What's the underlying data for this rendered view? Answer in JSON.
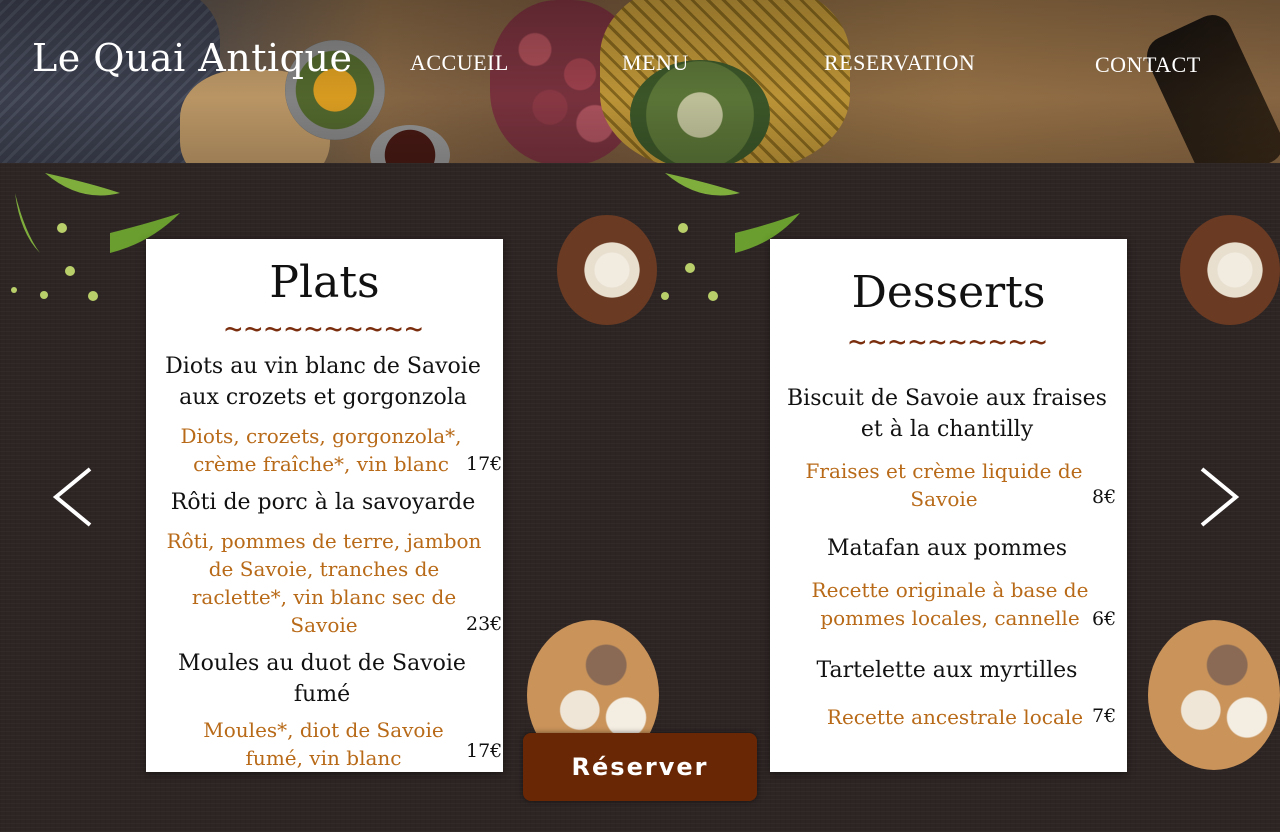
{
  "header": {
    "logo": "Le Quai Antique",
    "nav": [
      "ACCUEIL",
      "MENU",
      "RESERVATION",
      "CONTACT"
    ]
  },
  "cards": [
    {
      "title": "Plats",
      "divider": "~~~~~~~~~~",
      "items": [
        {
          "name": "Diots au vin blanc de Savoie aux crozets et gorgonzola",
          "desc": "Diots, crozets, gorgonzola*, crème fraîche*, vin blanc",
          "price": "17€"
        },
        {
          "name": "Rôti de porc à la savoyarde",
          "desc": "Rôti, pommes de terre, jambon de Savoie, tranches de raclette*, vin blanc sec de Savoie",
          "price": "23€"
        },
        {
          "name": "Moules au duot de Savoie fumé",
          "desc": "Moules*, diot de Savoie fumé, vin blanc",
          "price": "17€"
        }
      ]
    },
    {
      "title": "Desserts",
      "divider": "~~~~~~~~~~",
      "items": [
        {
          "name": "Biscuit de Savoie aux fraises et à la chantilly",
          "desc": "Fraises et crème liquide de Savoie",
          "price": "8€"
        },
        {
          "name": "Matafan aux pommes",
          "desc": "Recette originale à base de pommes locales, cannelle",
          "price": "6€"
        },
        {
          "name": "Tartelette aux myrtilles",
          "desc": "Recette ancestrale locale",
          "price": "7€"
        }
      ]
    }
  ],
  "reserve_button": "Réserver",
  "icons": {
    "prev": "chevron-left-icon",
    "next": "chevron-right-icon"
  },
  "colors": {
    "accent": "#6a2705",
    "desc": "#b86a18",
    "divider": "#7a2e0e"
  }
}
